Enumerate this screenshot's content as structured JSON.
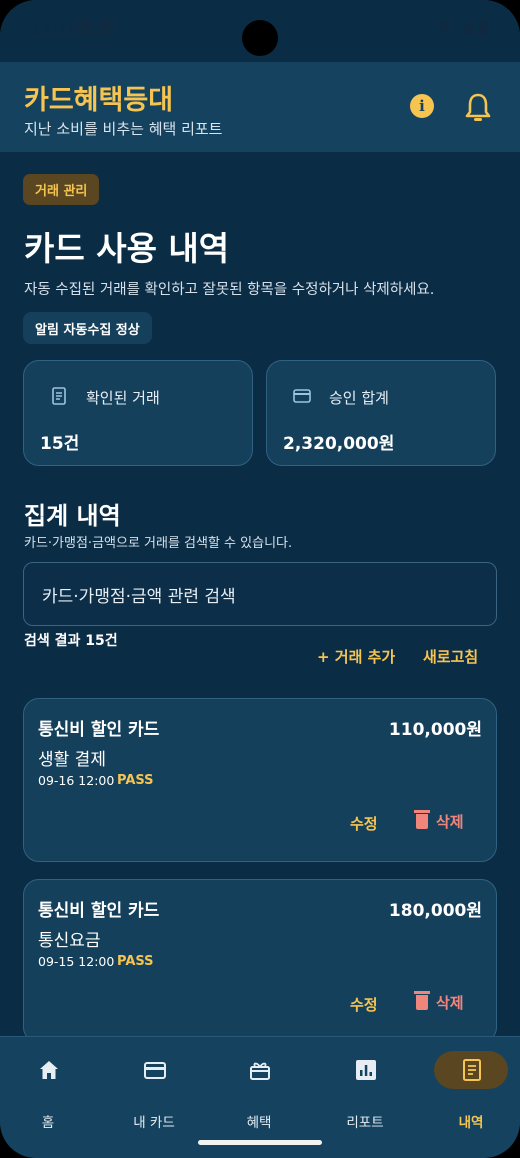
{
  "status_bar": {
    "time": "11:15"
  },
  "header": {
    "title": "카드혜택등대",
    "subtitle": "지난 소비를 비추는 혜택 리포트",
    "info_icon": "info-icon",
    "bell_icon": "bell-icon"
  },
  "page": {
    "badge": "거래 관리",
    "title": "카드 사용 내역",
    "description": "자동 수집된 거래를 확인하고 잘못된 항목을 수정하거나 삭제하세요.",
    "status_chip": "알림 자동수집 정상"
  },
  "stats": [
    {
      "label": "확인된 거래",
      "value": "15건",
      "icon": "receipt-icon"
    },
    {
      "label": "승인 합계",
      "value": "2,320,000원",
      "icon": "credit-card-icon"
    }
  ],
  "summary": {
    "title": "집계 내역",
    "description": "카드·가맹점·금액으로 거래를 검색할 수 있습니다.",
    "search_placeholder": "카드·가맹점·금액 관련 검색",
    "result_count": "검색 결과 15건",
    "add_label": "+ 거래 추가",
    "refresh_label": "새로고침"
  },
  "transactions": [
    {
      "card": "통신비 할인 카드",
      "amount": "110,000원",
      "category": "생활 결제",
      "date": "09-16 12:00",
      "status": "PASS",
      "edit": "수정",
      "delete": "삭제"
    },
    {
      "card": "통신비 할인 카드",
      "amount": "180,000원",
      "category": "통신요금",
      "date": "09-15 12:00",
      "status": "PASS",
      "edit": "수정",
      "delete": "삭제"
    }
  ],
  "nav": [
    {
      "label": "홈",
      "icon": "home-icon"
    },
    {
      "label": "내 카드",
      "icon": "credit-card-icon"
    },
    {
      "label": "혜택",
      "icon": "gift-icon"
    },
    {
      "label": "리포트",
      "icon": "bar-chart-icon"
    },
    {
      "label": "내역",
      "icon": "receipt-icon",
      "active": true
    }
  ],
  "colors": {
    "background": "#0b2c45",
    "surface": "#15405c",
    "accent": "#f5c451",
    "danger": "#f0857c"
  }
}
